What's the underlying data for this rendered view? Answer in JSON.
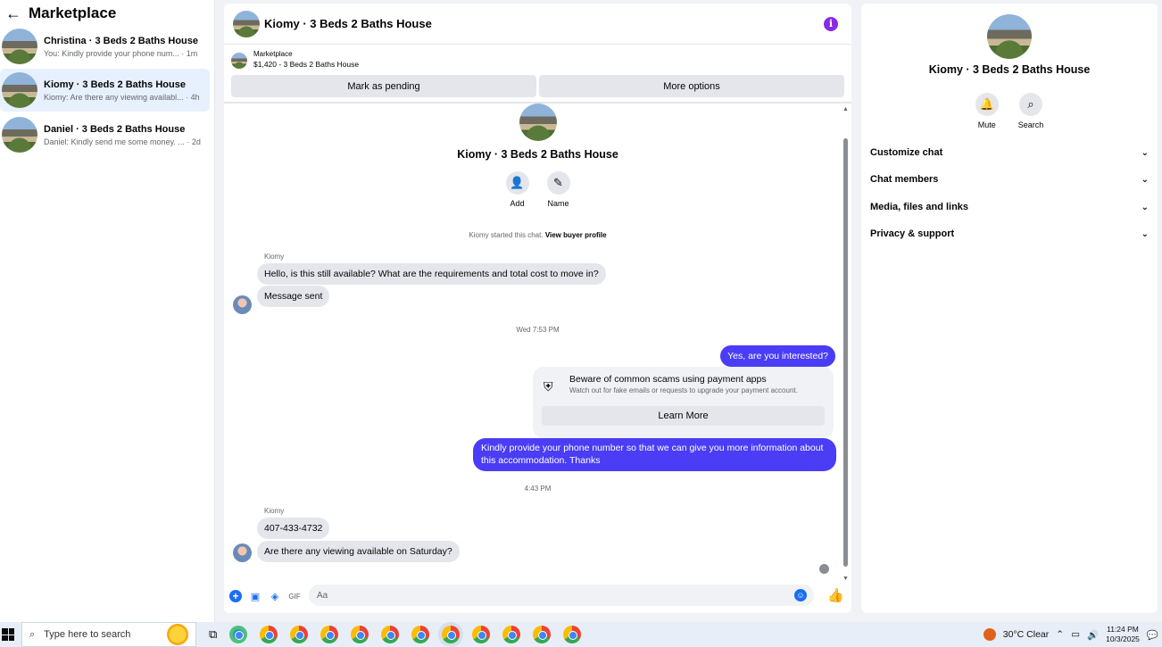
{
  "sidebar": {
    "title": "Marketplace",
    "conversations": [
      {
        "name": "Christina · 3 Beds 2 Baths House",
        "preview": "You: Kindly provide your phone num... · 1m"
      },
      {
        "name": "Kiomy · 3 Beds 2 Baths House",
        "preview": "Kiomy: Are there any viewing availabl... · 4h"
      },
      {
        "name": "Daniel · 3 Beds 2 Baths House",
        "preview": "Daniel: Kindly send me some money. ... · 2d"
      }
    ]
  },
  "chat": {
    "title": "Kiomy · 3 Beds 2 Baths House",
    "listing": {
      "source": "Marketplace",
      "details": "$1,420 - 3 Beds 2 Baths House"
    },
    "buttons": {
      "pending": "Mark as pending",
      "more": "More options"
    },
    "hero": {
      "title": "Kiomy · 3 Beds 2 Baths House",
      "add": "Add",
      "name": "Name"
    },
    "started": {
      "text": "Kiomy started this chat.",
      "link": "View buyer profile"
    },
    "messages": {
      "sender1": "Kiomy",
      "m1": "Hello, is this still available? What are the requirements and total cost to move in?",
      "m2": "Message sent",
      "ts1": "Wed 7:53 PM",
      "m3": "Yes, are you interested?",
      "scam_title": "Beware of common scams using payment apps",
      "scam_sub": "Watch out for fake emails or requests to upgrade your payment account.",
      "scam_btn": "Learn More",
      "m4": "Kindly provide your phone number so that we can give you more information about this accommodation. Thanks",
      "ts2": "4:43 PM",
      "sender2": "Kiomy",
      "m5": "407-433-4732",
      "m6": "Are there any viewing available on Saturday?"
    },
    "composer": {
      "placeholder": "Aa"
    }
  },
  "panel": {
    "title": "Kiomy · 3 Beds 2 Baths House",
    "mute": "Mute",
    "search": "Search",
    "sections": [
      "Customize chat",
      "Chat members",
      "Media, files and links",
      "Privacy & support"
    ]
  },
  "taskbar": {
    "search_placeholder": "Type here to search",
    "weather": "30°C  Clear",
    "time": "11:24 PM",
    "date": "10/3/2025"
  },
  "colors": {
    "accent": "#4a3df5",
    "link": "#1a6df5",
    "active_row": "#e7f1fd"
  }
}
